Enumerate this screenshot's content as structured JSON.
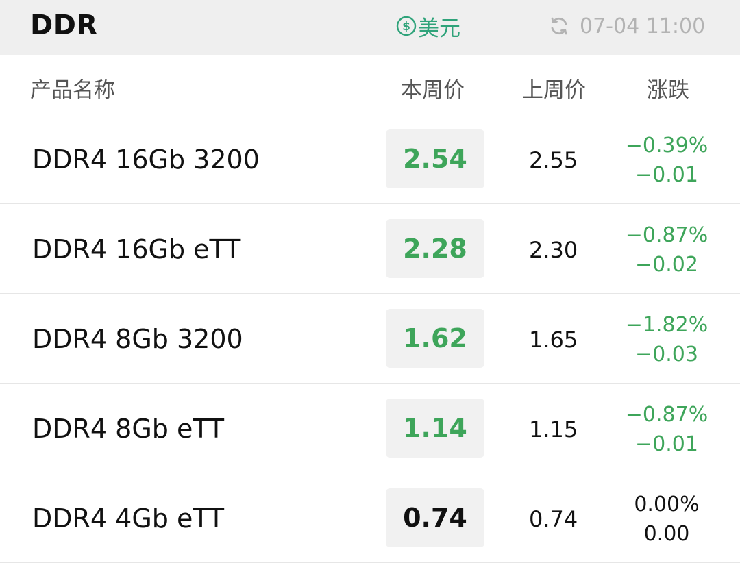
{
  "header": {
    "title": "DDR",
    "currency_label": "美元",
    "update_time": "07-04 11:00"
  },
  "columns": {
    "name": "产品名称",
    "this_week": "本周价",
    "last_week": "上周价",
    "change": "涨跌"
  },
  "colors": {
    "down": "#3ea55a",
    "flat": "#111111",
    "accent": "#2fa37a"
  },
  "rows": [
    {
      "name": "DDR4 16Gb 3200",
      "this_week": "2.54",
      "last_week": "2.55",
      "change_pct": "−0.39%",
      "change_abs": "−0.01",
      "trend": "down"
    },
    {
      "name": "DDR4 16Gb eTT",
      "this_week": "2.28",
      "last_week": "2.30",
      "change_pct": "−0.87%",
      "change_abs": "−0.02",
      "trend": "down"
    },
    {
      "name": "DDR4 8Gb 3200",
      "this_week": "1.62",
      "last_week": "1.65",
      "change_pct": "−1.82%",
      "change_abs": "−0.03",
      "trend": "down"
    },
    {
      "name": "DDR4 8Gb eTT",
      "this_week": "1.14",
      "last_week": "1.15",
      "change_pct": "−0.87%",
      "change_abs": "−0.01",
      "trend": "down"
    },
    {
      "name": "DDR4 4Gb eTT",
      "this_week": "0.74",
      "last_week": "0.74",
      "change_pct": "0.00%",
      "change_abs": "0.00",
      "trend": "flat"
    }
  ]
}
